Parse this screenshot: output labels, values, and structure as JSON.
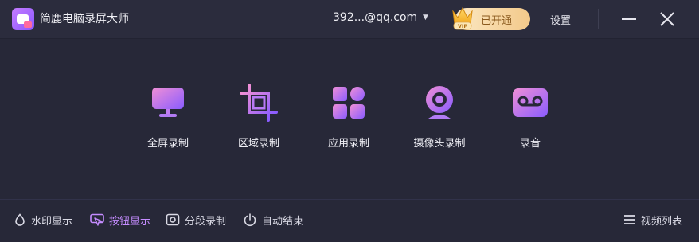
{
  "app": {
    "title": "简鹿电脑录屏大师"
  },
  "header": {
    "account": "392...@qq.com",
    "vip_badge": "VIP",
    "vip_status": "已开通",
    "settings": "设置"
  },
  "tools": [
    {
      "label": "全屏录制",
      "icon": "monitor-icon"
    },
    {
      "label": "区域录制",
      "icon": "crop-icon"
    },
    {
      "label": "应用录制",
      "icon": "apps-grid-icon"
    },
    {
      "label": "摄像头录制",
      "icon": "webcam-icon"
    },
    {
      "label": "录音",
      "icon": "cassette-icon"
    }
  ],
  "footer": {
    "items": [
      {
        "label": "水印显示",
        "icon": "water-drop-icon",
        "active": false
      },
      {
        "label": "按钮显示",
        "icon": "mouse-click-icon",
        "active": true
      },
      {
        "label": "分段录制",
        "icon": "camera-segment-icon",
        "active": false
      },
      {
        "label": "自动结束",
        "icon": "power-icon",
        "active": false
      }
    ],
    "video_list": "视频列表"
  },
  "colors": {
    "accent_start": "#ee8fd8",
    "accent_end": "#8a5cff",
    "footer_active": "#c58cff",
    "vip_gold": "#f3c98a"
  }
}
